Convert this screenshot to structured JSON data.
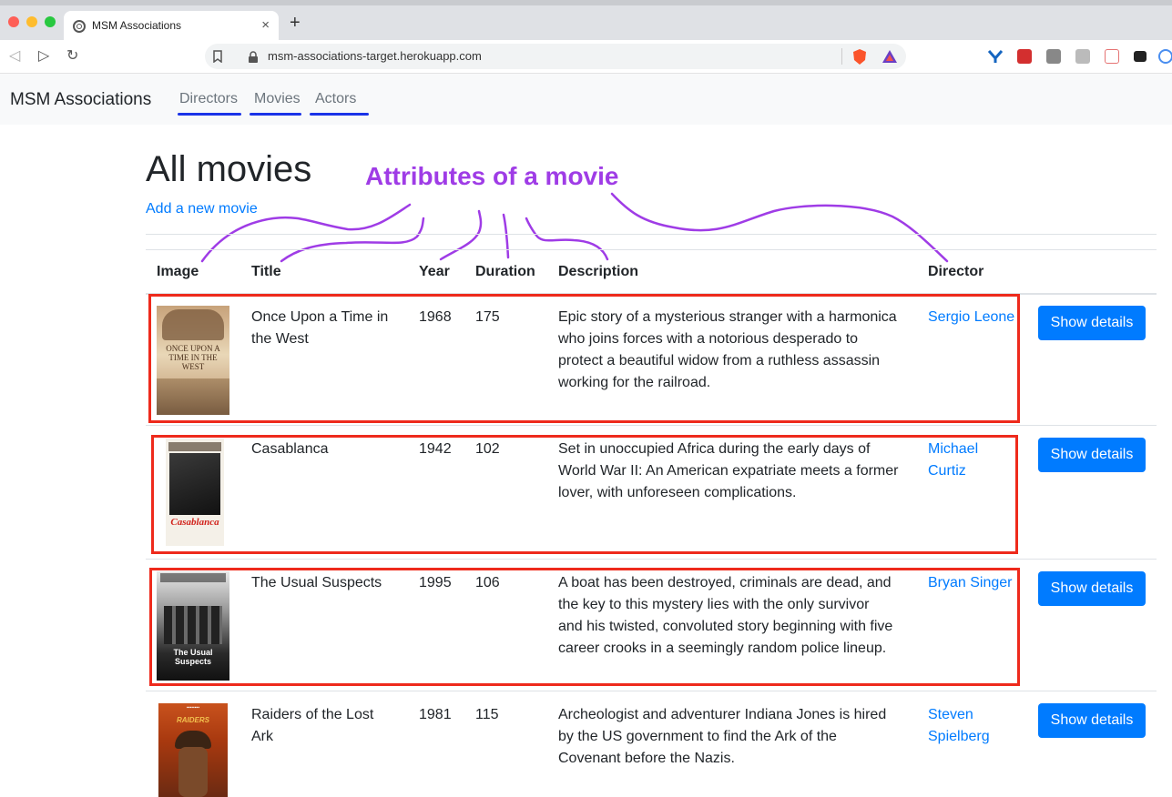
{
  "browser": {
    "tab_title": "MSM Associations",
    "url": "msm-associations-target.herokuapp.com"
  },
  "navbar": {
    "brand": "MSM Associations",
    "links": [
      "Directors",
      "Movies",
      "Actors"
    ]
  },
  "page": {
    "title": "All movies",
    "add_link": "Add a new movie",
    "annotation": "Attributes of a movie"
  },
  "table": {
    "headers": [
      "Image",
      "Title",
      "Year",
      "Duration",
      "Description",
      "Director"
    ],
    "rows": [
      {
        "title_l1": "Once Upon a Time in",
        "title_l2": "the West",
        "year": "1968",
        "duration": "175",
        "desc": [
          "Epic story of a mysterious stranger with a harmonica",
          "who joins forces with a notorious desperado to",
          "protect a beautiful widow from a ruthless assassin",
          "working for the railroad."
        ],
        "director": [
          "Sergio Leone"
        ],
        "poster_text": "ONCE UPON A TIME IN THE WEST",
        "button": "Show details"
      },
      {
        "title_l1": "Casablanca",
        "title_l2": "",
        "year": "1942",
        "duration": "102",
        "desc": [
          "Set in unoccupied Africa during the early days of",
          "World War II: An American expatriate meets a former",
          "lover, with unforeseen complications."
        ],
        "director": [
          "Michael",
          "Curtiz"
        ],
        "poster_text": "Casablanca",
        "button": "Show details"
      },
      {
        "title_l1": "The Usual Suspects",
        "title_l2": "",
        "year": "1995",
        "duration": "106",
        "desc": [
          "A boat has been destroyed, criminals are dead, and",
          "the key to this mystery lies with the only survivor",
          "and his twisted, convoluted story beginning with five",
          "career crooks in a seemingly random police lineup."
        ],
        "director": [
          "Bryan Singer"
        ],
        "poster_text": "The Usual Suspects",
        "button": "Show details"
      },
      {
        "title_l1": "Raiders of the Lost",
        "title_l2": "Ark",
        "year": "1981",
        "duration": "115",
        "desc": [
          "Archeologist and adventurer Indiana Jones is hired",
          "by the US government to find the Ark of the",
          "Covenant before the Nazis."
        ],
        "director": [
          "Steven",
          "Spielberg"
        ],
        "poster_text": "RAIDERS",
        "button": "Show details"
      }
    ]
  }
}
